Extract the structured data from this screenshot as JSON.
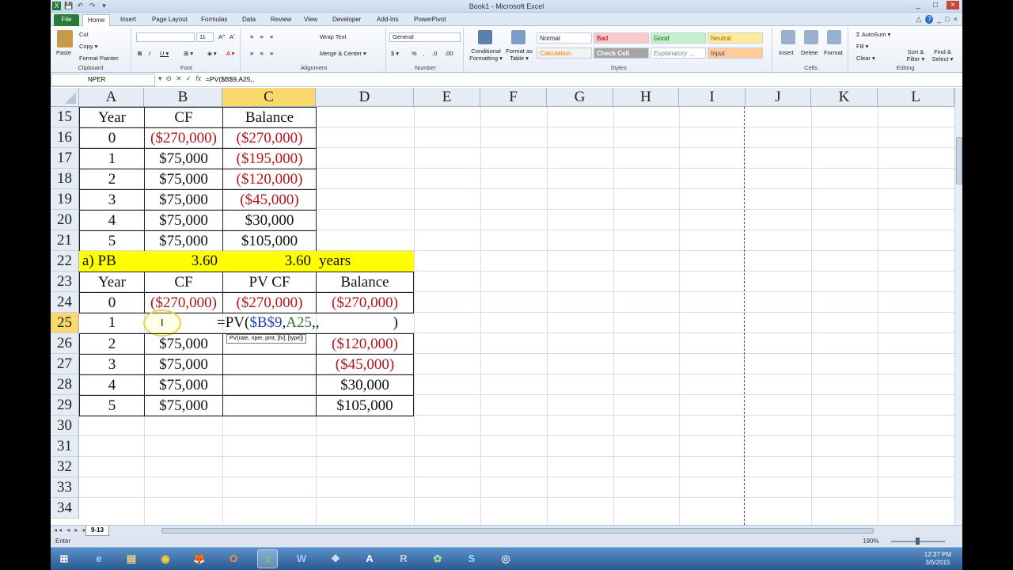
{
  "window": {
    "title": "Book1 - Microsoft Excel",
    "controls": [
      "_",
      "□",
      "×"
    ]
  },
  "quick_access": [
    "X",
    "💾",
    "↶",
    "↷",
    "▾"
  ],
  "tabs": [
    {
      "label": "File"
    },
    {
      "label": "Home"
    },
    {
      "label": "Insert"
    },
    {
      "label": "Page Layout"
    },
    {
      "label": "Formulas"
    },
    {
      "label": "Data"
    },
    {
      "label": "Review"
    },
    {
      "label": "View"
    },
    {
      "label": "Developer"
    },
    {
      "label": "Add-Ins"
    },
    {
      "label": "PowerPivot"
    }
  ],
  "tab_right_icons": [
    "△",
    "?",
    "_",
    "□",
    "×"
  ],
  "ribbon": {
    "clipboard": {
      "label": "Clipboard",
      "paste": "Paste",
      "cut": "Cut",
      "copy": "Copy ▾",
      "format_painter": "Format Painter"
    },
    "font": {
      "label": "Font",
      "size": "11",
      "bold": "B",
      "italic": "I",
      "underline": "U ▾",
      "grow": "A^",
      "shrink": "Aˇ",
      "border": "⊞ ▾",
      "fill": "◈ ▾",
      "color": "A ▾"
    },
    "alignment": {
      "label": "Alignment",
      "wrap_text": "Wrap Text",
      "merge_center": "Merge & Center ▾"
    },
    "number": {
      "label": "Number",
      "format": "General",
      "currency": "$ ▾",
      "percent": "%",
      "comma": ",",
      "inc_dec": ".0",
      "dec_dec": ".00"
    },
    "styles": {
      "label": "Styles",
      "conditional": "Conditional Formatting ▾",
      "format_table": "Format as Table ▾",
      "cells": [
        {
          "name": "Normal",
          "bg": "#ffffff",
          "fg": "#222222"
        },
        {
          "name": "Bad",
          "bg": "#ffc7ce",
          "fg": "#9c0006"
        },
        {
          "name": "Good",
          "bg": "#c6efce",
          "fg": "#006100"
        },
        {
          "name": "Neutral",
          "bg": "#ffeb9c",
          "fg": "#9c6500"
        },
        {
          "name": "Calculation",
          "bg": "#f2f2f2",
          "fg": "#fa7d00"
        },
        {
          "name": "Check Cell",
          "bg": "#a5a5a5",
          "fg": "#ffffff"
        },
        {
          "name": "Explanatory ...",
          "bg": "#ffffff",
          "fg": "#7f7f7f"
        },
        {
          "name": "Input",
          "bg": "#ffcc99",
          "fg": "#3f3f76"
        }
      ]
    },
    "cells": {
      "label": "Cells",
      "insert": "Insert",
      "delete": "Delete",
      "format": "Format"
    },
    "editing": {
      "label": "Editing",
      "autosum": "Σ AutoSum ▾",
      "fill": "Fill ▾",
      "clear": "Clear ▾",
      "sort": "Sort & Filter ▾",
      "find": "Find & Select ▾"
    }
  },
  "formula_bar": {
    "name_box": "NPER",
    "icons": [
      "▾",
      "⊖",
      "✕",
      "✓",
      "fx"
    ],
    "formula": "=PV($B$9,A25,,"
  },
  "columns": [
    "A",
    "B",
    "C",
    "D",
    "E",
    "F",
    "G",
    "H",
    "I",
    "J",
    "K",
    "L"
  ],
  "rows": [
    "15",
    "16",
    "17",
    "18",
    "19",
    "20",
    "21",
    "22",
    "23",
    "24",
    "25",
    "26",
    "27",
    "28",
    "29",
    "30",
    "31",
    "32",
    "33",
    "34"
  ],
  "table1": {
    "headers": [
      "Year",
      "CF",
      "Balance"
    ],
    "rows": [
      [
        "0",
        "($270,000)",
        "($270,000)"
      ],
      [
        "1",
        "$75,000",
        "($195,000)"
      ],
      [
        "2",
        "$75,000",
        "($120,000)"
      ],
      [
        "3",
        "$75,000",
        "($45,000)"
      ],
      [
        "4",
        "$75,000",
        "$30,000"
      ],
      [
        "5",
        "$75,000",
        "$105,000"
      ]
    ]
  },
  "payback": {
    "label": "a) PB",
    "value": "3.60",
    "value2": "3.60",
    "unit": "years",
    "highlight": "#ffff00"
  },
  "table2": {
    "headers": [
      "Year",
      "CF",
      "PV CF",
      "Balance"
    ],
    "rows": [
      [
        "0",
        "($270,000)",
        "($270,000)",
        "($270,000)"
      ],
      [
        "1",
        "",
        "=PV($B$9,A25,,",
        ")"
      ],
      [
        "2",
        "$75,000",
        "",
        "($120,000)"
      ],
      [
        "3",
        "$75,000",
        "",
        "($45,000)"
      ],
      [
        "4",
        "$75,000",
        "",
        "$30,000"
      ],
      [
        "5",
        "$75,000",
        "",
        "$105,000"
      ]
    ],
    "tooltip": "PV(rate, nper, pmt, [fv], [type])",
    "cursor": "I"
  },
  "sheet": {
    "tab": "9-13",
    "mode": "Enter",
    "zoom": "190%"
  },
  "taskbar": {
    "icons": [
      "⊞",
      "e",
      "▤",
      "◉",
      "🦊",
      "O",
      "X",
      "W",
      "❖",
      "A",
      "R",
      "✿",
      "S",
      "◎"
    ],
    "time": "12:37 PM",
    "date": "3/5/2015"
  }
}
